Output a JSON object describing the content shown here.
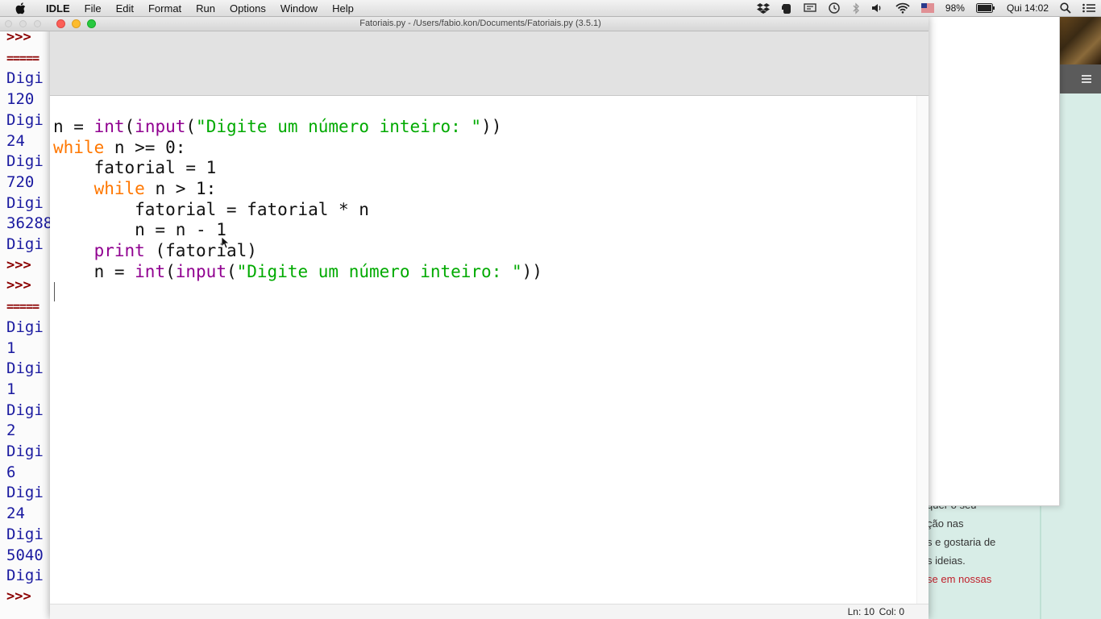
{
  "menubar": {
    "app_name": "IDLE",
    "items": [
      "File",
      "Edit",
      "Format",
      "Run",
      "Options",
      "Window",
      "Help"
    ],
    "battery": "98%",
    "clock": "Qui 14:02"
  },
  "shell": {
    "lines": [
      {
        "text": ">>>",
        "kind": "prompt"
      },
      {
        "text": "=====",
        "kind": "sep"
      },
      {
        "text": "Digi",
        "kind": "out"
      },
      {
        "text": "120",
        "kind": "out"
      },
      {
        "text": "Digi",
        "kind": "out"
      },
      {
        "text": "24",
        "kind": "out"
      },
      {
        "text": "Digi",
        "kind": "out"
      },
      {
        "text": "720",
        "kind": "out"
      },
      {
        "text": "Digi",
        "kind": "out"
      },
      {
        "text": "36288",
        "kind": "out"
      },
      {
        "text": "Digi",
        "kind": "out"
      },
      {
        "text": ">>>",
        "kind": "prompt"
      },
      {
        "text": ">>>",
        "kind": "prompt"
      },
      {
        "text": "=====",
        "kind": "sep"
      },
      {
        "text": "Digi",
        "kind": "out"
      },
      {
        "text": "1",
        "kind": "out"
      },
      {
        "text": "Digi",
        "kind": "out"
      },
      {
        "text": "1",
        "kind": "out"
      },
      {
        "text": "Digi",
        "kind": "out"
      },
      {
        "text": "2",
        "kind": "out"
      },
      {
        "text": "Digi",
        "kind": "out"
      },
      {
        "text": "6",
        "kind": "out"
      },
      {
        "text": "Digi",
        "kind": "out"
      },
      {
        "text": "24",
        "kind": "out"
      },
      {
        "text": "Digi",
        "kind": "out"
      },
      {
        "text": "5040",
        "kind": "out"
      },
      {
        "text": "Digi",
        "kind": "out"
      },
      {
        "text": ">>>",
        "kind": "prompt"
      }
    ]
  },
  "background": {
    "text_lines": [
      {
        "text": "quer o seu",
        "color": "#333333"
      },
      {
        "text": "ção nas",
        "color": "#333333"
      },
      {
        "text": "s e gostaria de",
        "color": "#333333"
      },
      {
        "text": "s ideias.",
        "color": "#333333"
      },
      {
        "text": "se em nossas",
        "color": "#c0202b"
      }
    ]
  },
  "editor": {
    "window_title": "Fatoriais.py - /Users/fabio.kon/Documents/Fatoriais.py (3.5.1)",
    "code_lines": [
      [
        {
          "t": "n = ",
          "c": "plain"
        },
        {
          "t": "int",
          "c": "bi"
        },
        {
          "t": "(",
          "c": "plain"
        },
        {
          "t": "input",
          "c": "bi"
        },
        {
          "t": "(",
          "c": "plain"
        },
        {
          "t": "\"Digite um número inteiro: \"",
          "c": "str"
        },
        {
          "t": "))",
          "c": "plain"
        }
      ],
      [
        {
          "t": "while",
          "c": "kw"
        },
        {
          "t": " n >= 0:",
          "c": "plain"
        }
      ],
      [
        {
          "t": "    fatorial = 1",
          "c": "plain"
        }
      ],
      [
        {
          "t": "    ",
          "c": "plain"
        },
        {
          "t": "while",
          "c": "kw"
        },
        {
          "t": " n > 1:",
          "c": "plain"
        }
      ],
      [
        {
          "t": "        fatorial = fatorial * n",
          "c": "plain"
        }
      ],
      [
        {
          "t": "        n = n - 1",
          "c": "plain"
        }
      ],
      [
        {
          "t": "    ",
          "c": "plain"
        },
        {
          "t": "print",
          "c": "bi"
        },
        {
          "t": " (fatorial)",
          "c": "plain"
        }
      ],
      [
        {
          "t": "    n = ",
          "c": "plain"
        },
        {
          "t": "int",
          "c": "bi"
        },
        {
          "t": "(",
          "c": "plain"
        },
        {
          "t": "input",
          "c": "bi"
        },
        {
          "t": "(",
          "c": "plain"
        },
        {
          "t": "\"Digite um número inteiro: \"",
          "c": "str"
        },
        {
          "t": "))",
          "c": "plain"
        }
      ]
    ],
    "status_line": "Ln: 10",
    "status_col": "Col: 0"
  }
}
